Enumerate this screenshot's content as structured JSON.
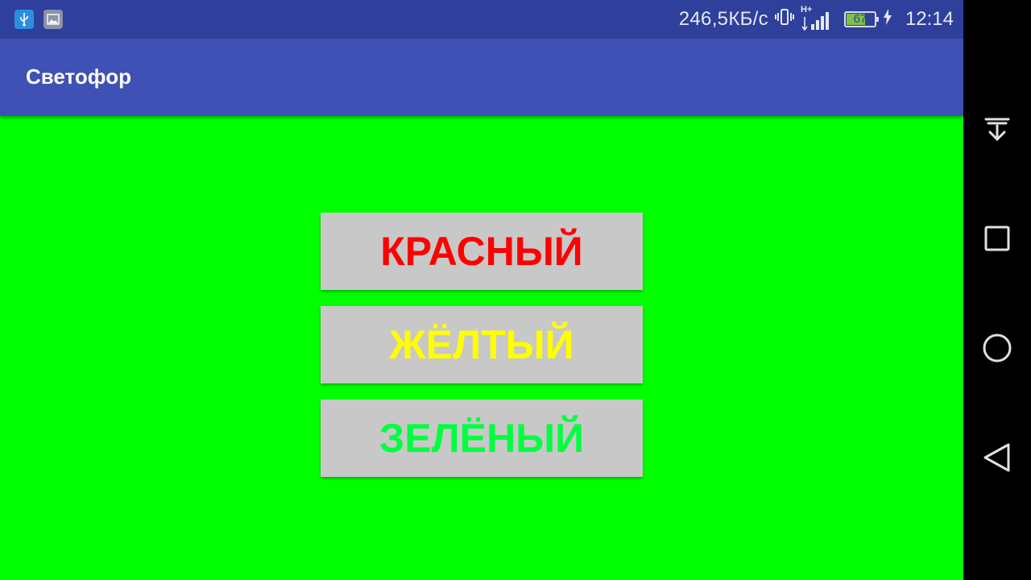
{
  "status_bar": {
    "net_speed": "246,5КБ/с",
    "network_type": "H+",
    "battery_level": "67",
    "time": "12:14",
    "icons": [
      "usb-icon",
      "image-icon",
      "vibrate-icon",
      "signal-icon",
      "battery-icon",
      "charging-icon"
    ]
  },
  "app_bar": {
    "title": "Светофор",
    "color": "#3f51b5"
  },
  "background_color": "#00ff00",
  "buttons": [
    {
      "label": "КРАСНЫЙ",
      "text_color": "#ff0000"
    },
    {
      "label": "ЖЁЛТЫЙ",
      "text_color": "#ffff00"
    },
    {
      "label": "ЗЕЛЁНЫЙ",
      "text_color": "#00ff40"
    }
  ],
  "nav_bar": {
    "icons": [
      "notifications-pull-down-icon",
      "recents-square-icon",
      "home-circle-icon",
      "back-triangle-icon"
    ]
  }
}
